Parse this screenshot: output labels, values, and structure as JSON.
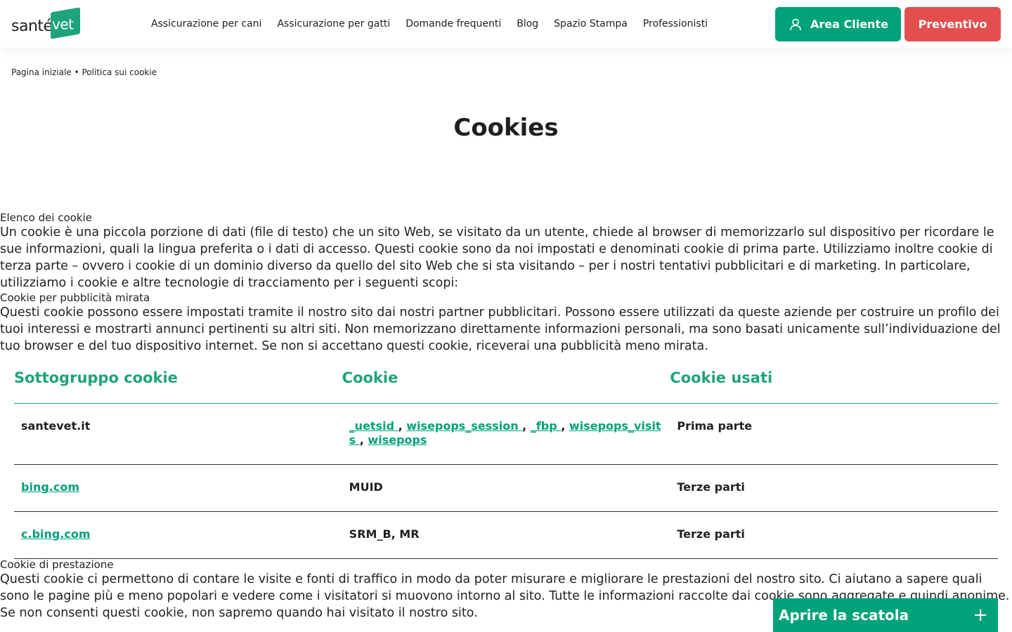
{
  "header": {
    "logo_text": "santé",
    "logo_box": "vet",
    "nav": [
      "Assicurazione per cani",
      "Assicurazione per gatti",
      "Domande frequenti",
      "Blog",
      "Spazio Stampa",
      "Professionisti"
    ],
    "area_cliente": "Area Cliente",
    "preventivo": "Preventivo"
  },
  "breadcrumb": {
    "home": "Pagina iniziale",
    "sep": "•",
    "current": "Politica sui cookie"
  },
  "title": "Cookies",
  "section1": {
    "heading": "Elenco dei cookie",
    "intro": "Un cookie è una piccola porzione di dati (file di testo) che un sito Web, se visitato da un utente, chiede al browser di memorizzarlo sul dispositivo per ricordare le sue informazioni, quali la lingua preferita o i dati di accesso. Questi cookie sono da noi impostati e denominati cookie di prima parte. Utilizziamo inoltre cookie di terza parte – ovvero i cookie di un dominio diverso da quello del sito Web che si sta visitando – per i nostri tentativi pubblicitari e di marketing. In particolare, utilizziamo i cookie e altre tecnologie di tracciamento per i seguenti scopi:",
    "sub_heading": "Cookie per pubblicità mirata",
    "sub_text": "Questi cookie possono essere impostati tramite il nostro sito dai nostri partner pubblicitari. Possono essere utilizzati da queste aziende per costruire un profilo dei tuoi interessi e mostrarti annunci pertinenti su altri siti. Non memorizzano direttamente informazioni personali, ma sono basati unicamente sull’individuazione del tuo browser e del tuo dispositivo internet. Se non si accettano questi cookie, riceverai una pubblicità meno mirata."
  },
  "table": {
    "headers": [
      "Sottogruppo cookie",
      "Cookie",
      "Cookie usati"
    ],
    "rows": [
      {
        "subgroup": "santevet.it",
        "cookies": [
          " _uetsid ",
          " wisepops_session ",
          " _fbp ",
          " wisepops_visits ",
          " wisepops"
        ],
        "used": "Prima parte"
      },
      {
        "subgroup": "bing.com",
        "cookies_text": "MUID",
        "used": "Terze parti"
      },
      {
        "subgroup": "c.bing.com",
        "cookies_text": "SRM_B, MR",
        "used": "Terze parti"
      }
    ]
  },
  "section2": {
    "heading": "Cookie di prestazione",
    "text": "Questi cookie ci permettono di contare le visite e fonti di traffico in modo da poter misurare e migliorare le prestazioni del nostro sito. Ci aiutano a sapere quali sono le pagine più e meno popolari e vedere come i visitatori si muovono intorno al sito. Tutte le informazioni raccolte dai cookie sono aggregate e quindi anonime. Se non consenti questi cookie, non sapremo quando hai visitato il nostro sito."
  },
  "box_button": {
    "label": "Aprire la scatola",
    "icon": "+"
  },
  "colors": {
    "brand_green": "#00a27a",
    "cta_red": "#e34f4f"
  }
}
